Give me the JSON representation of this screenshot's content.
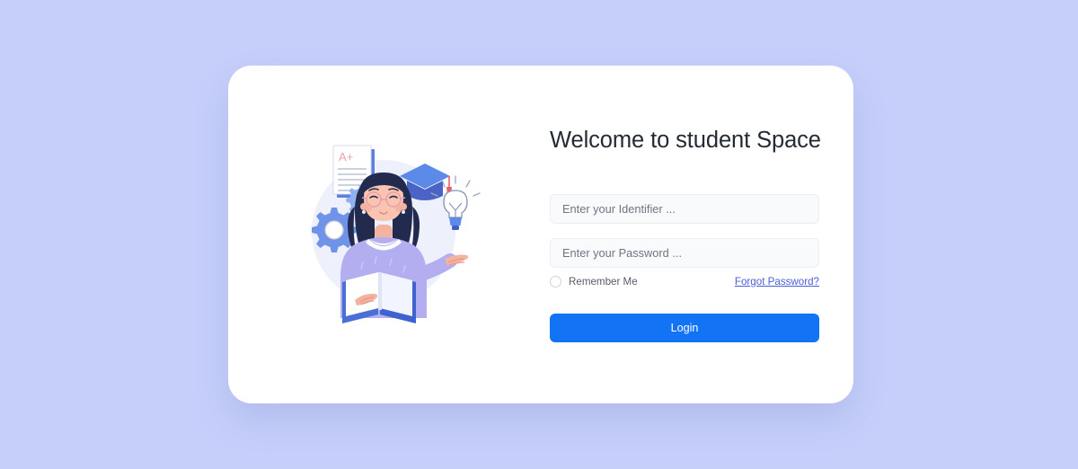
{
  "theme": {
    "page_background": "#c6cffa",
    "card_background": "#ffffff",
    "accent_blue": "#1273f5",
    "link_blue": "#4b5fd6",
    "field_background": "#f9fafc",
    "title_color": "#242a33"
  },
  "card": {
    "title": "Welcome to student Space",
    "illustration": {
      "name": "student-reading-illustration",
      "elements": [
        "a-plus-paper-icon",
        "graduation-cap-icon",
        "lightbulb-icon",
        "gears-icon",
        "student-with-book"
      ],
      "paper_grade": "A+",
      "backdrop_color": "#eef1fb",
      "primary_blue": "#4d6fd4",
      "sweater_color": "#b3aef0",
      "hair_color": "#222a4d",
      "tassel_color": "#e8616d"
    },
    "form": {
      "identifier": {
        "placeholder": "Enter your Identifier ...",
        "value": ""
      },
      "password": {
        "placeholder": "Enter your Password ...",
        "value": ""
      },
      "remember_me": {
        "label": "Remember Me",
        "checked": false
      },
      "forgot_password_label": "Forgot Password?",
      "submit_label": "Login"
    }
  }
}
